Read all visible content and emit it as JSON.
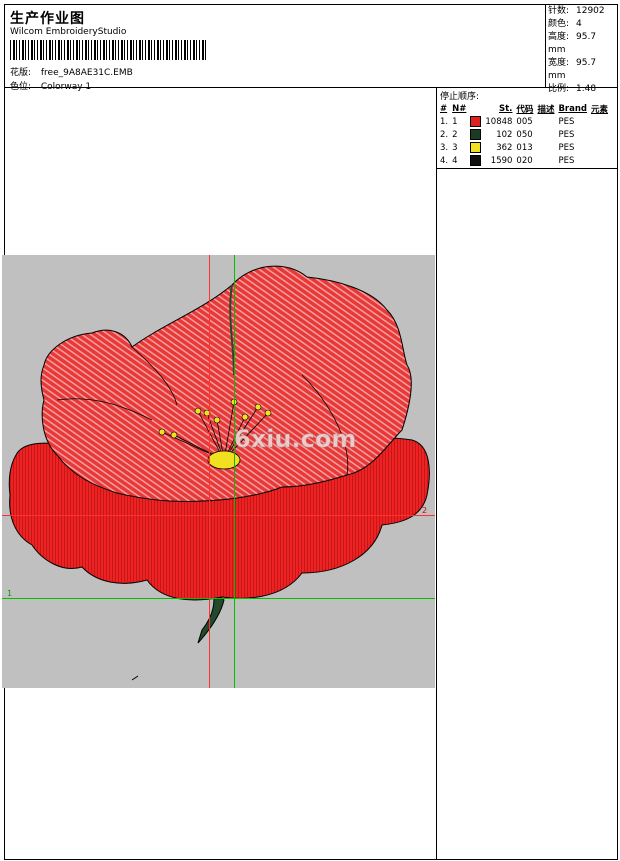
{
  "header": {
    "title": "生产作业图",
    "company": "Wilcom EmbroideryStudio",
    "file_label": "花版:",
    "file_name": "free_9A8AE31C.EMB",
    "colorway_label": "色位:",
    "colorway_name": "Colorway 1"
  },
  "stats": [
    {
      "k": "针数:",
      "v": "12902"
    },
    {
      "k": "颜色:",
      "v": "4"
    },
    {
      "k": "高度:",
      "v": "95.7 mm"
    },
    {
      "k": "宽度:",
      "v": "95.7 mm"
    },
    {
      "k": "比例:",
      "v": "1.48"
    }
  ],
  "sequence": {
    "heading": "停止顺序:",
    "columns": [
      "#",
      "N#",
      "St.",
      "代码",
      "描述",
      "Brand",
      "元素"
    ],
    "rows": [
      {
        "idx": "1.",
        "n": "1",
        "color": "#e02020",
        "st": "10848",
        "code": "005",
        "desc": "",
        "brand": "PES"
      },
      {
        "idx": "2.",
        "n": "2",
        "color": "#1c3a24",
        "st": "102",
        "code": "050",
        "desc": "",
        "brand": "PES"
      },
      {
        "idx": "3.",
        "n": "3",
        "color": "#f0e020",
        "st": "362",
        "code": "013",
        "desc": "",
        "brand": "PES"
      },
      {
        "idx": "4.",
        "n": "4",
        "color": "#101010",
        "st": "1590",
        "code": "020",
        "desc": "",
        "brand": "PES"
      }
    ]
  },
  "canvas": {
    "background": "#c0c0c0",
    "watermark": "6xiu.com",
    "marker_1": "1",
    "marker_2": "2"
  }
}
